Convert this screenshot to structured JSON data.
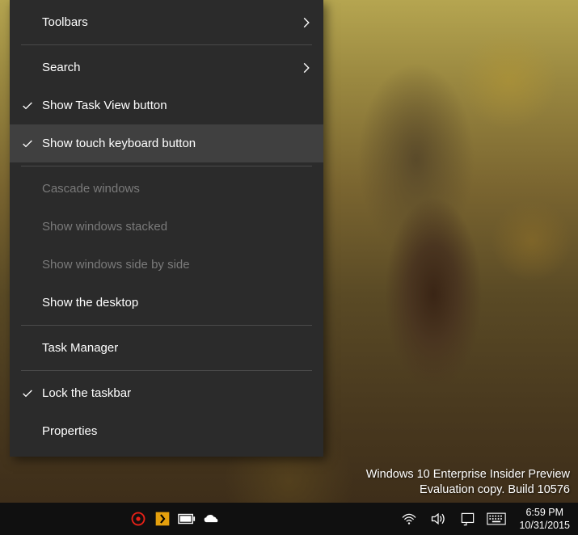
{
  "context_menu": {
    "items": [
      {
        "label": "Toolbars",
        "submenu": true
      },
      {
        "sep": true
      },
      {
        "label": "Search",
        "submenu": true
      },
      {
        "label": "Show Task View button",
        "checked": true
      },
      {
        "label": "Show touch keyboard button",
        "checked": true,
        "highlighted": true
      },
      {
        "sep": true
      },
      {
        "label": "Cascade windows",
        "disabled": true
      },
      {
        "label": "Show windows stacked",
        "disabled": true
      },
      {
        "label": "Show windows side by side",
        "disabled": true
      },
      {
        "label": "Show the desktop"
      },
      {
        "sep": true
      },
      {
        "label": "Task Manager"
      },
      {
        "sep": true
      },
      {
        "label": "Lock the taskbar",
        "checked": true
      },
      {
        "label": "Properties"
      }
    ]
  },
  "watermark": {
    "line1": "Windows 10 Enterprise Insider Preview",
    "line2": "Evaluation copy. Build 10576"
  },
  "taskbar": {
    "clock": {
      "time": "6:59 PM",
      "date": "10/31/2015"
    }
  }
}
